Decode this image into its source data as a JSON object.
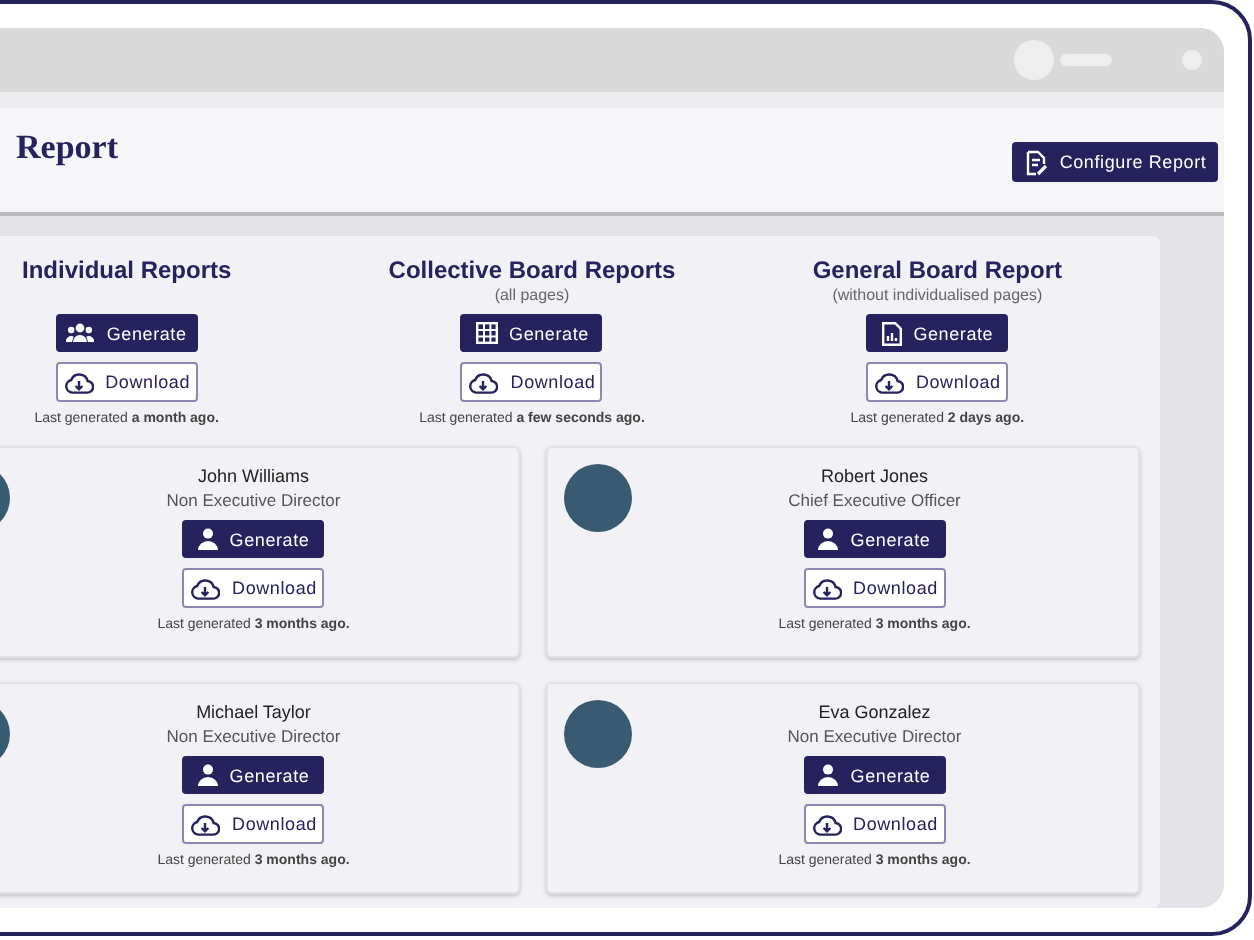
{
  "page": {
    "title": "Report",
    "configure_button": "Configure Report"
  },
  "report_types": [
    {
      "kind": "group",
      "title": "Individual Reports",
      "generate": "Generate",
      "download": "Download",
      "last_generated": "Last generated **a month ago.**"
    },
    {
      "kind": "table",
      "title": "Collective Board Reports",
      "subtitle": "(all pages)",
      "generate": "Generate",
      "download": "Download",
      "last_generated": "Last generated **a few seconds ago.**"
    },
    {
      "kind": "document",
      "title": "General Board Report",
      "subtitle": "(without individualised pages)",
      "generate": "Generate",
      "download": "Download",
      "last_generated": "Last generated **2 days ago.**"
    }
  ],
  "people": [
    {
      "name": "John Williams",
      "role": "Non Executive Director",
      "generate": "Generate",
      "download": "Download",
      "last_generated": "Last generated **3 months ago.**"
    },
    {
      "name": "Robert Jones",
      "role": "Chief Executive Officer",
      "generate": "Generate",
      "download": "Download",
      "last_generated": "Last generated **3 months ago.**"
    },
    {
      "name": "Michael Taylor",
      "role": "Non Executive Director",
      "generate": "Generate",
      "download": "Download",
      "last_generated": "Last generated **3 months ago.**"
    },
    {
      "name": "Eva Gonzalez",
      "role": "Non Executive Director",
      "generate": "Generate",
      "download": "Download",
      "last_generated": "Last generated **3 months ago.**"
    }
  ]
}
